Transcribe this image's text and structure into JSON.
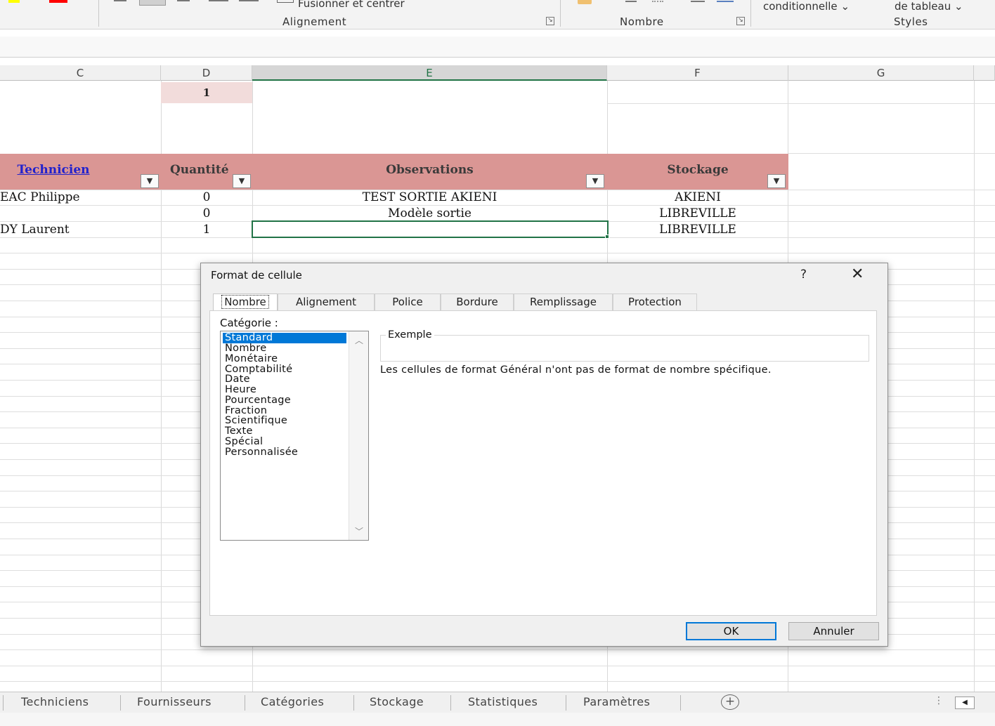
{
  "ribbon": {
    "fusion_label": "Fusionner et centrer",
    "group_alignement": "Alignement",
    "group_nombre": "Nombre",
    "conditional": "conditionnelle",
    "table_format": "de tableau",
    "group_styles": "Styles"
  },
  "columns": [
    "C",
    "D",
    "E",
    "F",
    "G"
  ],
  "sheet": {
    "d1_value": "1",
    "headers": {
      "technicien": "Technicien",
      "quantite": "Quantité",
      "observations": "Observations",
      "stockage": "Stockage"
    },
    "rows": [
      {
        "technicien": "EAC Philippe",
        "quantite": "0",
        "observations": "TEST SORTIE AKIENI",
        "stockage": "AKIENI"
      },
      {
        "technicien": "",
        "quantite": "0",
        "observations": "Modèle sortie",
        "stockage": "LIBREVILLE"
      },
      {
        "technicien": "DY Laurent",
        "quantite": "1",
        "observations": "",
        "stockage": "LIBREVILLE"
      }
    ]
  },
  "dialog": {
    "title": "Format de cellule",
    "help": "?",
    "tabs": [
      "Nombre",
      "Alignement",
      "Police",
      "Bordure",
      "Remplissage",
      "Protection"
    ],
    "category_label": "Catégorie :",
    "categories": [
      "Standard",
      "Nombre",
      "Monétaire",
      "Comptabilité",
      "Date",
      "Heure",
      "Pourcentage",
      "Fraction",
      "Scientifique",
      "Texte",
      "Spécial",
      "Personnalisée"
    ],
    "selected_category": "Standard",
    "example_label": "Exemple",
    "description": "Les cellules de format Général n'ont pas de format de nombre spécifique.",
    "ok": "OK",
    "cancel": "Annuler"
  },
  "sheet_tabs": [
    "Techniciens",
    "Fournisseurs",
    "Catégories",
    "Stockage",
    "Statistiques",
    "Paramètres"
  ]
}
